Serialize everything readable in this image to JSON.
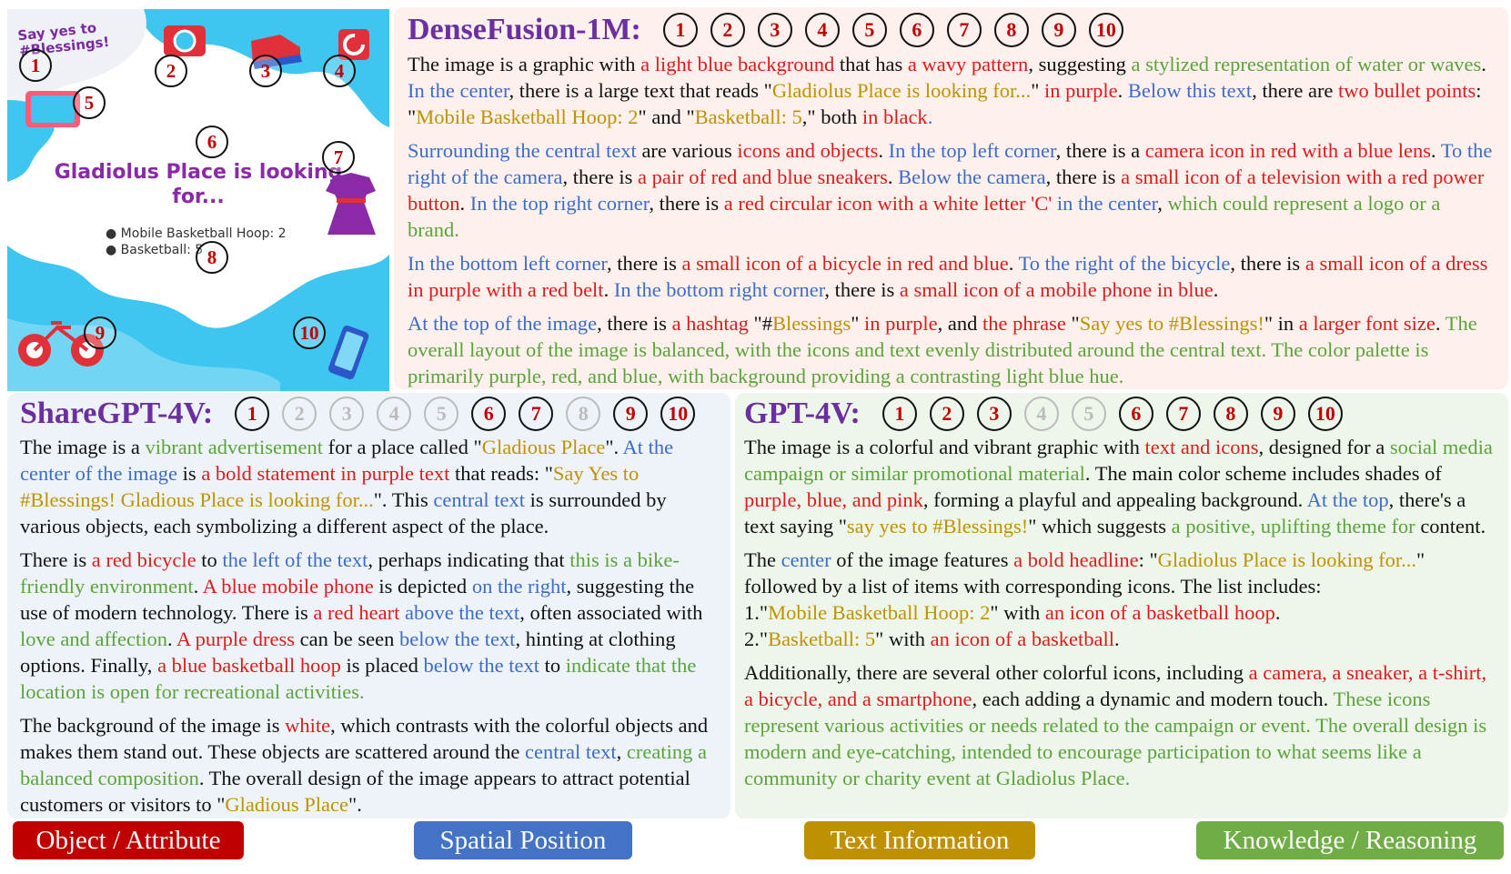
{
  "poster": {
    "say_yes": "Say yes to #Blessings!",
    "headline": "Gladiolus Place is looking for...",
    "bullets": [
      "Mobile Basketball Hoop: 2",
      "Basketball: 5"
    ],
    "markers": [
      "1",
      "2",
      "3",
      "4",
      "5",
      "6",
      "7",
      "8",
      "9",
      "10"
    ]
  },
  "densefusion": {
    "title": "DenseFusion-1M:",
    "circles": [
      {
        "n": "1",
        "on": true
      },
      {
        "n": "2",
        "on": true
      },
      {
        "n": "3",
        "on": true
      },
      {
        "n": "4",
        "on": true
      },
      {
        "n": "5",
        "on": true
      },
      {
        "n": "6",
        "on": true
      },
      {
        "n": "7",
        "on": true
      },
      {
        "n": "8",
        "on": true
      },
      {
        "n": "9",
        "on": true
      },
      {
        "n": "10",
        "on": true
      }
    ],
    "paragraphs": [
      [
        [
          "k",
          "The image is a graphic with "
        ],
        [
          "r",
          "a light blue background"
        ],
        [
          "k",
          " that has "
        ],
        [
          "r",
          "a wavy pattern"
        ],
        [
          "k",
          ", suggesting "
        ],
        [
          "g",
          "a stylized representation of water or waves"
        ],
        [
          "k",
          ". "
        ],
        [
          "b",
          "In the center"
        ],
        [
          "k",
          ", there is a large text that reads \""
        ],
        [
          "y",
          "Gladiolus Place is looking for..."
        ],
        [
          "k",
          "\" "
        ],
        [
          "r",
          "in purple"
        ],
        [
          "k",
          ". "
        ],
        [
          "b",
          "Below this text"
        ],
        [
          "k",
          ", there are "
        ],
        [
          "r",
          "two bullet points"
        ],
        [
          "k",
          ": \""
        ],
        [
          "y",
          "Mobile Basketball Hoop: 2"
        ],
        [
          "k",
          "\" and \""
        ],
        [
          "y",
          "Basketball: 5"
        ],
        [
          "k",
          ",\" both "
        ],
        [
          "r",
          "in black"
        ],
        [
          "b",
          "."
        ]
      ],
      [
        [
          "b",
          "Surrounding the central text"
        ],
        [
          "k",
          " are various "
        ],
        [
          "r",
          "icons and objects"
        ],
        [
          "k",
          ". "
        ],
        [
          "b",
          "In the top left corner"
        ],
        [
          "k",
          ", there is a "
        ],
        [
          "r",
          "camera icon in red with a blue lens"
        ],
        [
          "k",
          ". "
        ],
        [
          "b",
          "To the right of the camera"
        ],
        [
          "k",
          ", there is "
        ],
        [
          "r",
          "a pair of red and blue sneakers"
        ],
        [
          "k",
          ". "
        ],
        [
          "b",
          "Below the camera"
        ],
        [
          "k",
          ", there is "
        ],
        [
          "r",
          "a small icon of a television with a red power button"
        ],
        [
          "k",
          ". "
        ],
        [
          "b",
          "In the top right corner"
        ],
        [
          "k",
          ", there is "
        ],
        [
          "r",
          "a red circular icon with a white letter 'C'"
        ],
        [
          "b",
          " in the center"
        ],
        [
          "k",
          ", "
        ],
        [
          "g",
          "which could represent a logo or a brand."
        ]
      ],
      [
        [
          "b",
          "In the bottom left corner"
        ],
        [
          "k",
          ", there is "
        ],
        [
          "r",
          "a small icon of a bicycle in red and blue"
        ],
        [
          "k",
          ". "
        ],
        [
          "b",
          "To the right of the bicycle"
        ],
        [
          "k",
          ", there is "
        ],
        [
          "r",
          "a small icon of a dress in purple with a red belt"
        ],
        [
          "k",
          ". "
        ],
        [
          "b",
          "In the bottom right corner"
        ],
        [
          "k",
          ", there is "
        ],
        [
          "r",
          "a small icon of a mobile phone in blue"
        ],
        [
          "k",
          "."
        ]
      ],
      [
        [
          "b",
          "At the top of the image"
        ],
        [
          "k",
          ", there is "
        ],
        [
          "r",
          "a hashtag"
        ],
        [
          "k",
          " \"#"
        ],
        [
          "y",
          "Blessings"
        ],
        [
          "k",
          "\" "
        ],
        [
          "r",
          "in purple"
        ],
        [
          "k",
          ", and "
        ],
        [
          "r",
          "the phrase"
        ],
        [
          "k",
          " \""
        ],
        [
          "y",
          "Say yes to #Blessings!"
        ],
        [
          "k",
          "\" in "
        ],
        [
          "r",
          "a larger font size"
        ],
        [
          "k",
          ". "
        ],
        [
          "g",
          "The overall layout of the image is balanced, with the icons and text evenly distributed around the central text. The color palette is primarily purple, red, and blue, with background providing a contrasting light blue hue."
        ]
      ]
    ]
  },
  "sharegpt4v": {
    "title": "ShareGPT-4V:",
    "circles": [
      {
        "n": "1",
        "on": true
      },
      {
        "n": "2",
        "on": false
      },
      {
        "n": "3",
        "on": false
      },
      {
        "n": "4",
        "on": false
      },
      {
        "n": "5",
        "on": false
      },
      {
        "n": "6",
        "on": true
      },
      {
        "n": "7",
        "on": true
      },
      {
        "n": "8",
        "on": false
      },
      {
        "n": "9",
        "on": true
      },
      {
        "n": "10",
        "on": true
      }
    ],
    "paragraphs": [
      [
        [
          "k",
          "The image is a "
        ],
        [
          "g",
          "vibrant advertisement"
        ],
        [
          "k",
          " for a place called \""
        ],
        [
          "y",
          "Gladious Place"
        ],
        [
          "k",
          "\". "
        ],
        [
          "b",
          "At the center of the image"
        ],
        [
          "k",
          " is "
        ],
        [
          "r",
          "a bold statement in purple text"
        ],
        [
          "k",
          " that reads: \""
        ],
        [
          "y",
          "Say Yes to #Blessings! Gladious Place is looking for..."
        ],
        [
          "k",
          "\". This "
        ],
        [
          "b",
          "central text"
        ],
        [
          "k",
          " is surrounded by various objects, each symbolizing a different aspect of the place."
        ]
      ],
      [
        [
          "k",
          "There is "
        ],
        [
          "r",
          "a red bicycle"
        ],
        [
          "k",
          " to "
        ],
        [
          "b",
          "the left of the text"
        ],
        [
          "k",
          ", perhaps indicating that "
        ],
        [
          "g",
          "this is a bike-friendly environment"
        ],
        [
          "k",
          ". "
        ],
        [
          "r",
          "A blue mobile phone"
        ],
        [
          "k",
          " is depicted "
        ],
        [
          "b",
          "on the right"
        ],
        [
          "k",
          ", suggesting the use of modern technology. There is "
        ],
        [
          "r",
          "a red heart"
        ],
        [
          "b",
          " above the text"
        ],
        [
          "k",
          ", often associated with "
        ],
        [
          "g",
          "love and affection"
        ],
        [
          "k",
          ". "
        ],
        [
          "r",
          "A purple dress"
        ],
        [
          "k",
          " can be seen "
        ],
        [
          "b",
          "below the text"
        ],
        [
          "k",
          ", hinting at clothing options. Finally, "
        ],
        [
          "r",
          "a blue basketball hoop"
        ],
        [
          "k",
          " is placed "
        ],
        [
          "b",
          "below the text"
        ],
        [
          "k",
          " to "
        ],
        [
          "g",
          "indicate that the location is open for recreational activities."
        ]
      ],
      [
        [
          "k",
          "The background of the image is "
        ],
        [
          "r",
          "white"
        ],
        [
          "k",
          ", which contrasts with the colorful objects and makes them stand out. These objects are scattered around the "
        ],
        [
          "b",
          "central text"
        ],
        [
          "k",
          ", "
        ],
        [
          "g",
          "creating a balanced composition"
        ],
        [
          "k",
          ". The overall design of the image appears to attract potential customers or visitors to \""
        ],
        [
          "y",
          "Gladious Place"
        ],
        [
          "k",
          "\"."
        ]
      ]
    ]
  },
  "gpt4v": {
    "title": "GPT-4V:",
    "circles": [
      {
        "n": "1",
        "on": true
      },
      {
        "n": "2",
        "on": true
      },
      {
        "n": "3",
        "on": true
      },
      {
        "n": "4",
        "on": false
      },
      {
        "n": "5",
        "on": false
      },
      {
        "n": "6",
        "on": true
      },
      {
        "n": "7",
        "on": true
      },
      {
        "n": "8",
        "on": true
      },
      {
        "n": "9",
        "on": true
      },
      {
        "n": "10",
        "on": true
      }
    ],
    "paragraphs": [
      [
        [
          "k",
          "The image is a colorful and vibrant graphic with "
        ],
        [
          "r",
          "text and icons"
        ],
        [
          "k",
          ", designed for a "
        ],
        [
          "g",
          "social media campaign or similar promotional material"
        ],
        [
          "k",
          ". The main color scheme includes shades of "
        ],
        [
          "r",
          "purple, blue, and pink"
        ],
        [
          "k",
          ", forming a playful and appealing background. "
        ],
        [
          "b",
          "At the top"
        ],
        [
          "k",
          ", there's a text saying \""
        ],
        [
          "y",
          "say yes to #Blessings!"
        ],
        [
          "k",
          "\" which suggests "
        ],
        [
          "g",
          "a positive, uplifting theme for"
        ],
        [
          "k",
          " content."
        ]
      ],
      [
        [
          "k",
          "The "
        ],
        [
          "b",
          "center"
        ],
        [
          "k",
          " of the image features "
        ],
        [
          "r",
          "a bold headline"
        ],
        [
          "k",
          ": \""
        ],
        [
          "y",
          "Gladiolus Place is looking for..."
        ],
        [
          "k",
          "\" followed by a list of items with corresponding icons. The list includes:"
        ],
        [
          "br",
          ""
        ],
        [
          "k",
          "1.\""
        ],
        [
          "y",
          "Mobile Basketball Hoop: 2"
        ],
        [
          "k",
          "\" with "
        ],
        [
          "r",
          "an icon of a basketball hoop"
        ],
        [
          "k",
          "."
        ],
        [
          "br",
          ""
        ],
        [
          "k",
          "2.\""
        ],
        [
          "y",
          "Basketball: 5"
        ],
        [
          "k",
          "\" with "
        ],
        [
          "r",
          "an icon of a basketball"
        ],
        [
          "k",
          "."
        ]
      ],
      [
        [
          "k",
          "Additionally, there are several other colorful icons, including "
        ],
        [
          "r",
          "a camera, a sneaker, a t-shirt, a bicycle, and a smartphone"
        ],
        [
          "k",
          ", each adding a dynamic and modern touch. "
        ],
        [
          "g",
          "These icons represent various activities or needs related to the campaign or event. The overall design is modern and eye-catching, intended to encourage participation to what seems like a community or charity event at Gladiolus Place."
        ]
      ]
    ]
  },
  "legend": [
    {
      "label": "Object / Attribute",
      "color": "#c00000"
    },
    {
      "label": "Spatial Position",
      "color": "#4472c4"
    },
    {
      "label": "Text Information",
      "color": "#bf9000"
    },
    {
      "label": "Knowledge / Reasoning",
      "color": "#70ad47"
    }
  ]
}
